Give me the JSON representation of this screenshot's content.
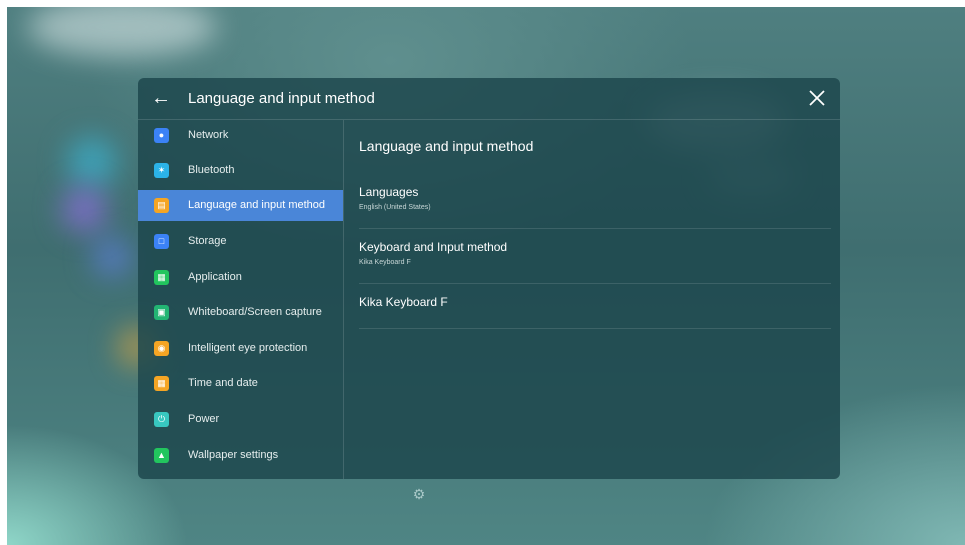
{
  "header": {
    "title": "Language and input method"
  },
  "sidebar": {
    "items": [
      {
        "label": "Network",
        "icon": "globe-icon",
        "color": "#3b82f6"
      },
      {
        "label": "Bluetooth",
        "icon": "bluetooth-icon",
        "color": "#2bb3e8"
      },
      {
        "label": "Language and input method",
        "icon": "keyboard-icon",
        "color": "#f5a524"
      },
      {
        "label": "Storage",
        "icon": "storage-icon",
        "color": "#3b82f6"
      },
      {
        "label": "Application",
        "icon": "apps-grid-icon",
        "color": "#22c55e"
      },
      {
        "label": "Whiteboard/Screen capture",
        "icon": "screen-capture-icon",
        "color": "#22b573"
      },
      {
        "label": "Intelligent eye protection",
        "icon": "eye-icon",
        "color": "#f5a524"
      },
      {
        "label": "Time and date",
        "icon": "calendar-icon",
        "color": "#f5a524"
      },
      {
        "label": "Power",
        "icon": "power-icon",
        "color": "#38c7c0"
      },
      {
        "label": "Wallpaper settings",
        "icon": "wallpaper-icon",
        "color": "#22c55e"
      }
    ],
    "active_index": 2,
    "active_color": "#4a86d8"
  },
  "content": {
    "title": "Language and input method",
    "rows": [
      {
        "title": "Languages",
        "subtitle": "English (United States)"
      },
      {
        "title": "Keyboard and Input method",
        "subtitle": "Kika Keyboard F"
      },
      {
        "title": "Kika Keyboard F"
      }
    ]
  },
  "dock": {
    "icon": "settings-gear-icon"
  }
}
